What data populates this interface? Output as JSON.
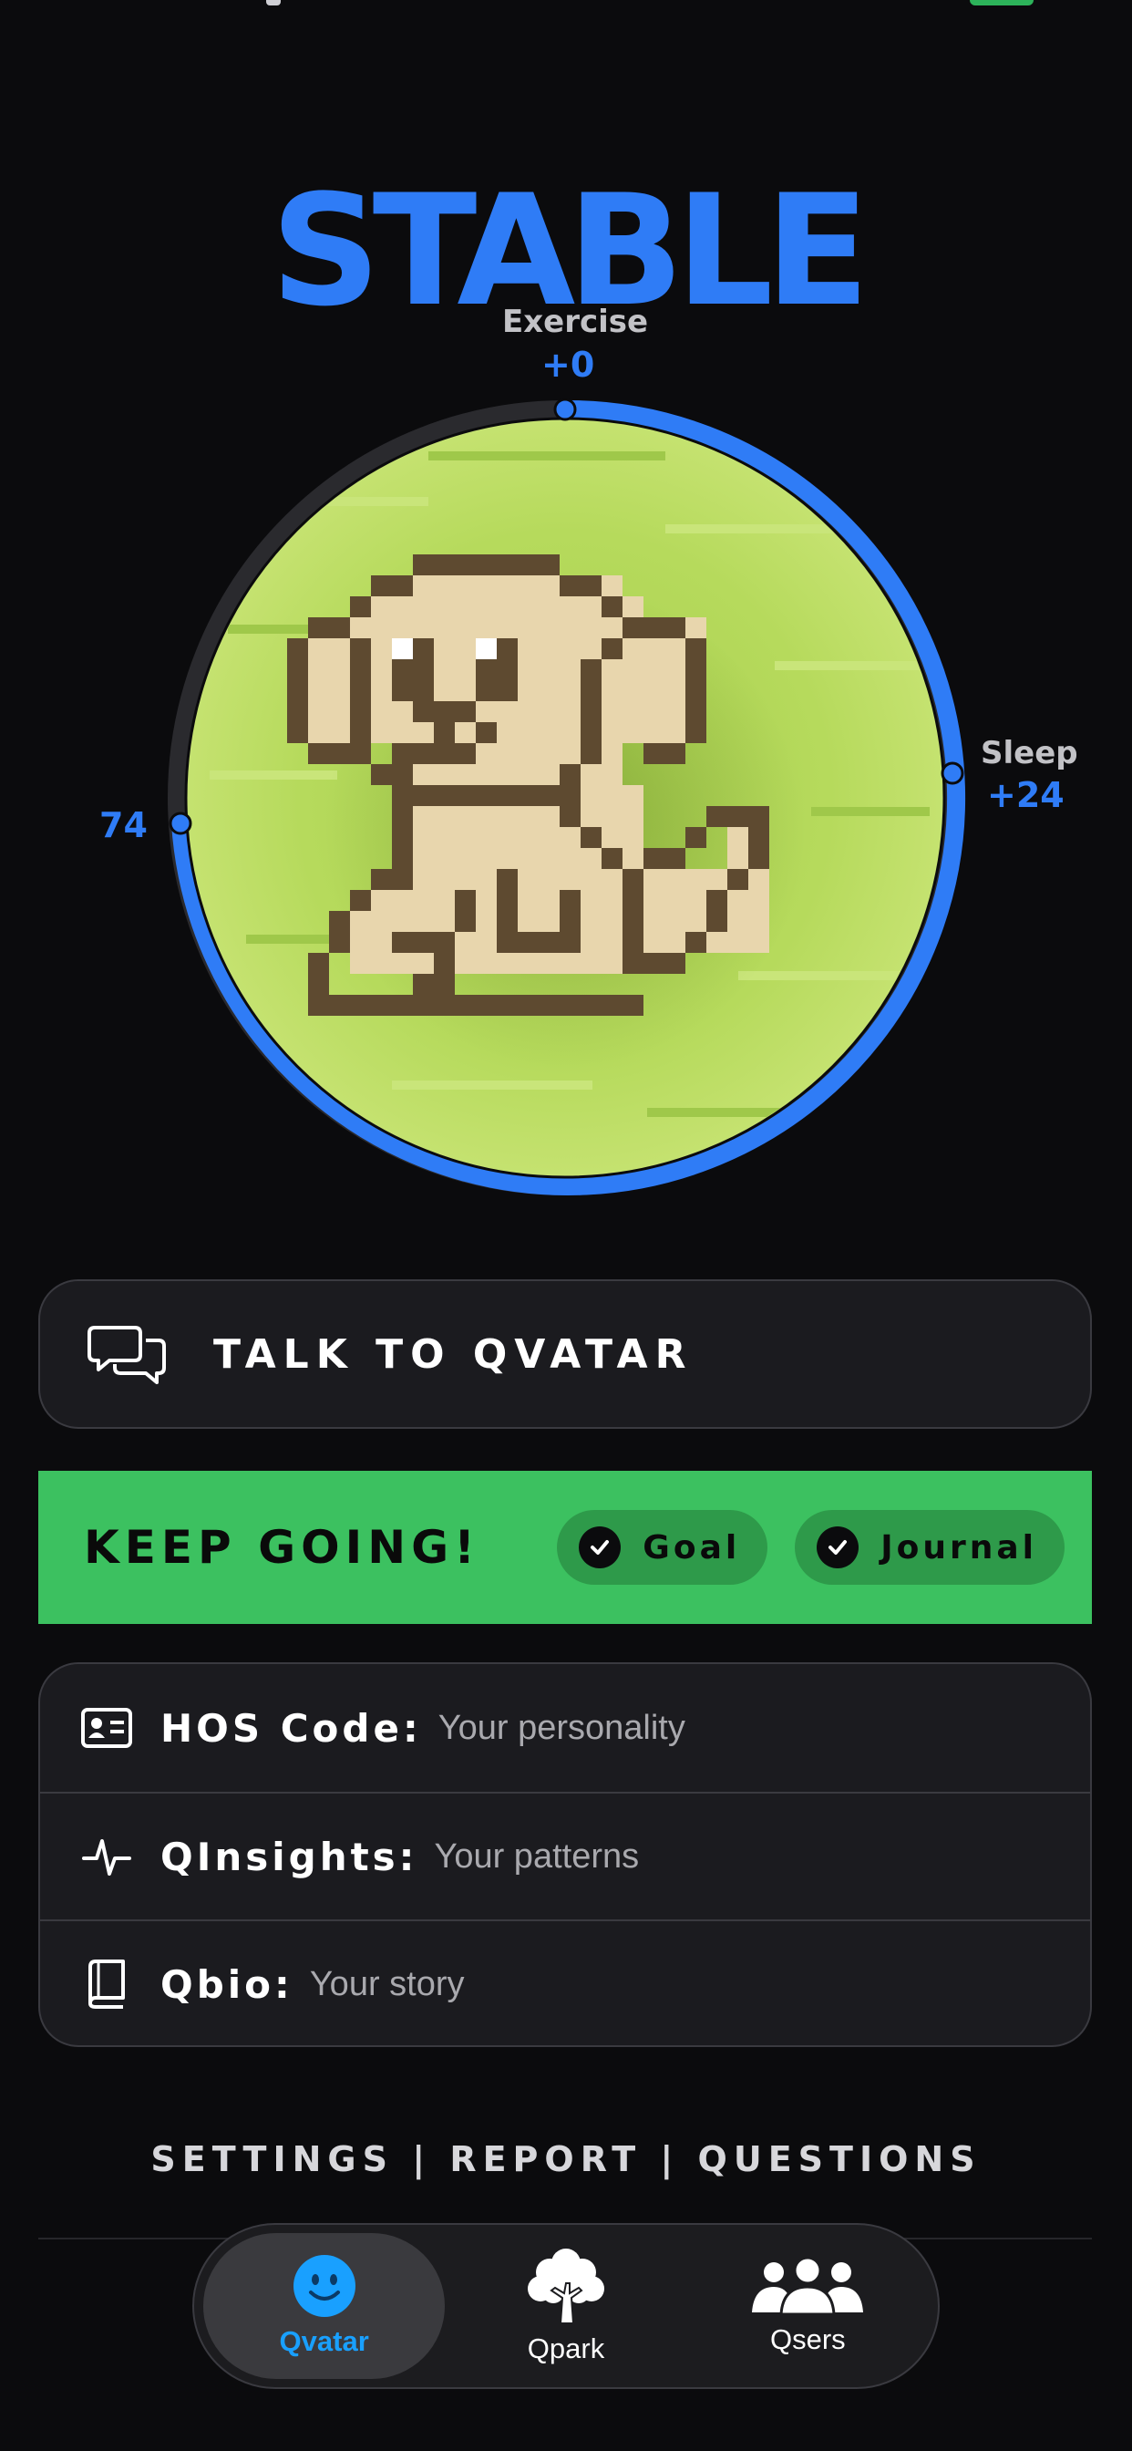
{
  "status_word": "STABLE",
  "stats": {
    "exercise": {
      "label": "Exercise",
      "value": "+0"
    },
    "sleep": {
      "label": "Sleep",
      "value": "+24"
    },
    "score": {
      "value": "74"
    }
  },
  "colors": {
    "accent": "#2f7cf6",
    "banner": "#3cc160",
    "tab_active": "#19a0ff",
    "grass": "#b4d85a",
    "dog_body": "#e8d6ad",
    "dog_outline": "#5e4a30"
  },
  "avatar": {
    "icon": "pixel-dog-avatar"
  },
  "talk_button": {
    "label": "TALK TO QVATAR",
    "icon": "chat-bubbles-icon"
  },
  "banner": {
    "title": "KEEP GOING!",
    "chips": [
      {
        "label": "Goal",
        "icon": "check-icon"
      },
      {
        "label": "Journal",
        "icon": "check-icon"
      }
    ]
  },
  "links": [
    {
      "label": "HOS Code:",
      "desc": "Your personality",
      "icon": "id-card-icon"
    },
    {
      "label": "QInsights:",
      "desc": "Your patterns",
      "icon": "pulse-icon"
    },
    {
      "label": "Qbio:",
      "desc": "Your story",
      "icon": "book-icon"
    }
  ],
  "footer": {
    "settings": "SETTINGS",
    "report": "REPORT",
    "questions": "QUESTIONS",
    "separator": "|"
  },
  "tabs": [
    {
      "label": "Qvatar",
      "icon": "smiley-icon",
      "active": true
    },
    {
      "label": "Qpark",
      "icon": "tree-icon",
      "active": false
    },
    {
      "label": "Qsers",
      "icon": "people-icon",
      "active": false
    }
  ]
}
